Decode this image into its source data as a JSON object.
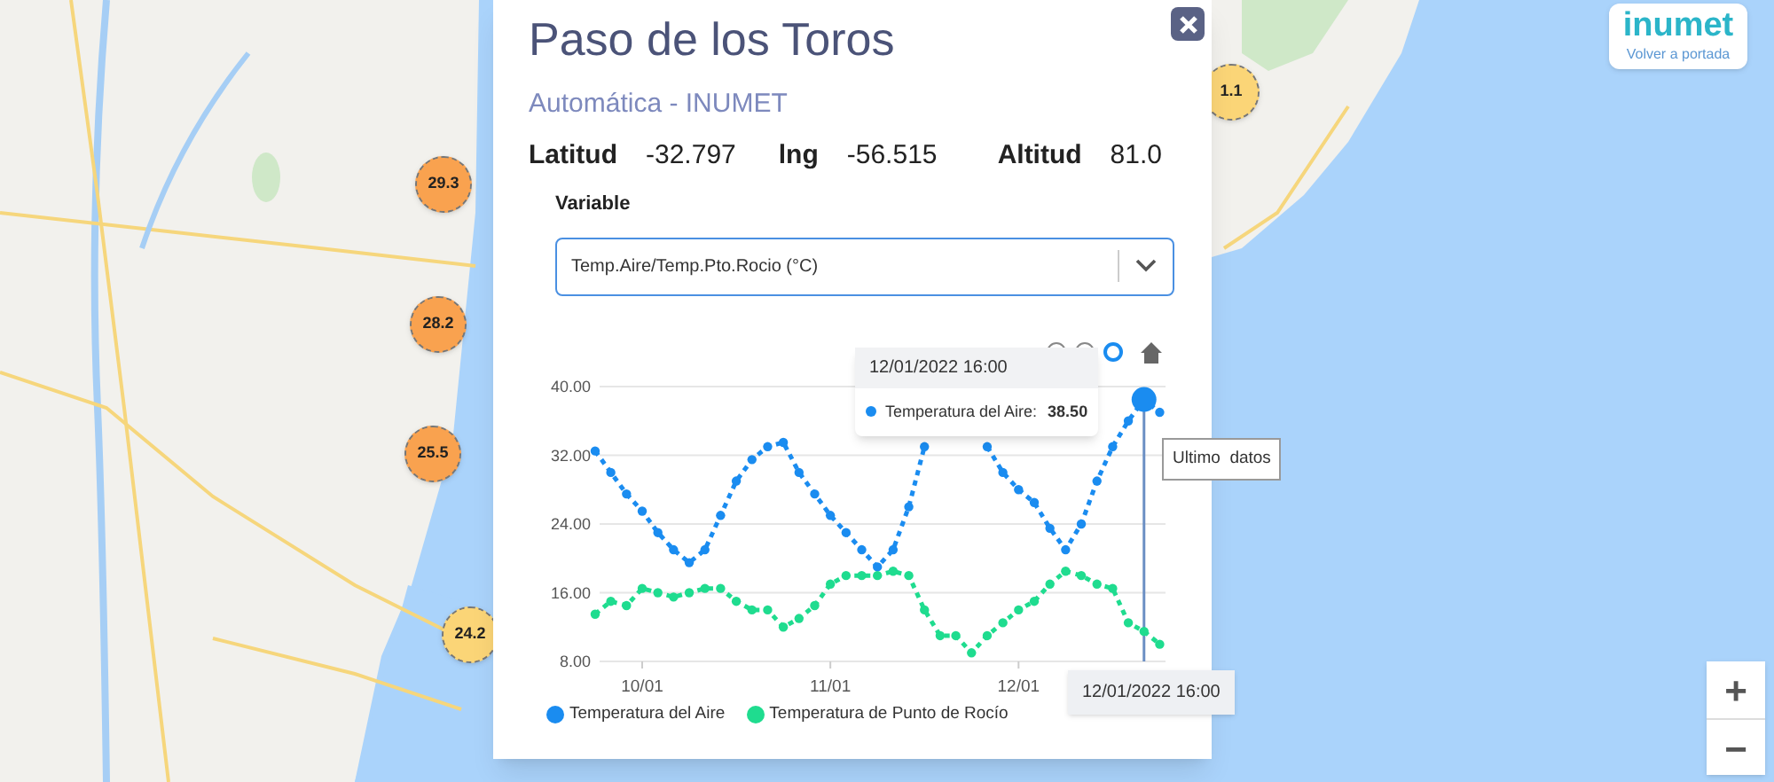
{
  "map": {
    "markers": [
      {
        "value": "29.3",
        "color": "#f9a24f"
      },
      {
        "value": "28.2",
        "color": "#f9a24f"
      },
      {
        "value": "25.5",
        "color": "#f9a24f"
      },
      {
        "value": "24.2",
        "color": "#fbd577"
      },
      {
        "value": "1.1",
        "color": "#fbd577"
      }
    ]
  },
  "logo": {
    "name": "inumet",
    "link": "Volver a portada"
  },
  "zoom_controls": [
    "+",
    "−"
  ],
  "station_popup": {
    "title": "Paso de los Toros",
    "subtitle": "Automática - INUMET",
    "coords": [
      {
        "label": "Latitud",
        "value": "-32.797"
      },
      {
        "label": "lng",
        "value": "-56.515"
      },
      {
        "label": "Altitud",
        "value": "81.0"
      }
    ],
    "variable": {
      "label": "Variable",
      "value": "Temp.Aire/Temp.Pto.Rocio (°C)"
    },
    "chart": {
      "range_options": [
        {
          "selected": false
        },
        {
          "selected": false
        },
        {
          "selected": true
        }
      ],
      "tooltip": {
        "title": "12/01/2022 16:00",
        "series": "Temperatura del Aire:",
        "value": "38.50"
      },
      "crosshair_label": "12/01/2022 16:00",
      "annotation": "Ultimo  datos",
      "chart_data": {
        "type": "line",
        "categories": [
          null,
          null,
          null,
          "10/01",
          null,
          null,
          null,
          null,
          null,
          null,
          null,
          null,
          null,
          null,
          null,
          "11/01",
          null,
          null,
          null,
          null,
          null,
          null,
          null,
          null,
          null,
          null,
          null,
          "12/01",
          null,
          null,
          null,
          null,
          null,
          null,
          null,
          null,
          null
        ],
        "yticks": [
          {
            "value": 8,
            "label": "8.00"
          },
          {
            "value": 16,
            "label": "16.00"
          },
          {
            "value": 24,
            "label": "24.00"
          },
          {
            "value": 32,
            "label": "32.00"
          },
          {
            "value": 40,
            "label": "40.00"
          }
        ],
        "ylim": [
          8,
          40
        ],
        "grid": true,
        "legend": true,
        "series": [
          {
            "name": "Temperatura del Aire",
            "color": "#1a8cf0",
            "line_style": "dotted",
            "marker": "circle",
            "values": [
              32.5,
              30,
              27.5,
              25.5,
              23,
              21,
              19.5,
              21,
              25,
              29,
              31.5,
              33,
              33.5,
              30,
              27.5,
              25,
              23,
              21,
              19,
              21,
              26,
              33,
              null,
              null,
              null,
              33,
              30,
              28,
              26.5,
              23.5,
              21,
              24,
              29,
              33,
              36,
              38.5,
              37
            ]
          },
          {
            "name": "Temperatura de Punto de Rocío",
            "color": "#1fdc8f",
            "line_style": "dotted",
            "marker": "circle",
            "values": [
              13.5,
              15,
              14.5,
              16.5,
              16,
              15.5,
              16,
              16.5,
              16.5,
              15,
              14,
              14,
              12,
              13,
              14.5,
              17,
              18,
              18,
              18,
              18.5,
              18,
              14,
              11,
              11,
              9,
              11,
              12.5,
              14,
              15,
              17,
              18.5,
              18,
              17,
              16.5,
              12.5,
              11.5,
              10
            ]
          }
        ]
      }
    }
  }
}
